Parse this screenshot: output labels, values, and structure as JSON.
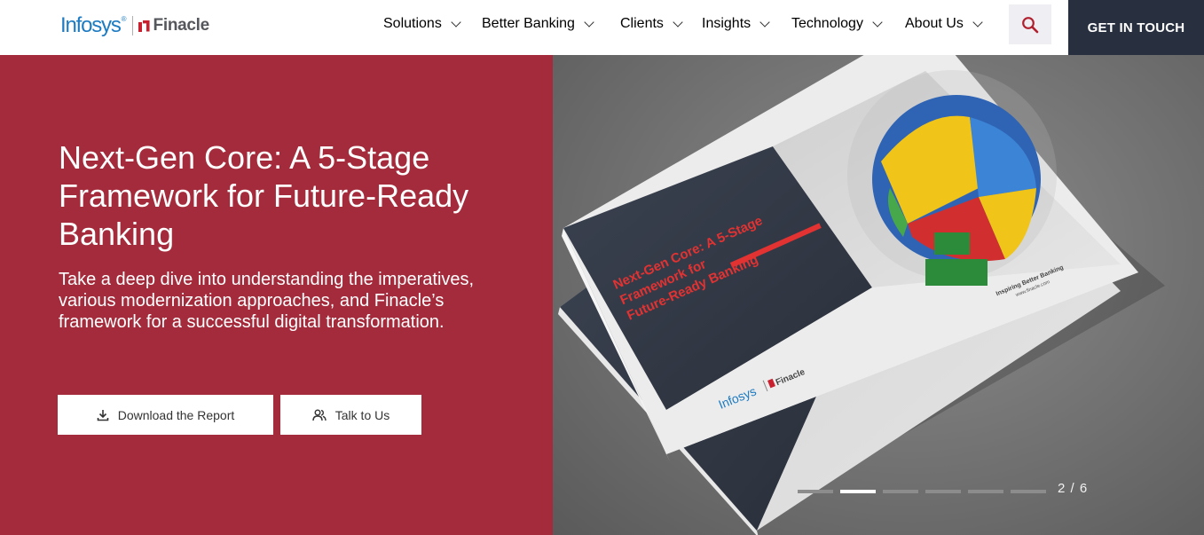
{
  "brand": {
    "infosys": "Infosys",
    "finacle": "Finacle",
    "primary_color": "#1d7bc2",
    "accent_color": "#c8202f"
  },
  "nav": {
    "items": [
      {
        "label": "Solutions",
        "icon": "chevron-down-icon"
      },
      {
        "label": "Better Banking",
        "icon": "chevron-down-icon"
      },
      {
        "label": "Clients",
        "icon": "chevron-down-icon"
      },
      {
        "label": "Insights",
        "icon": "chevron-down-icon"
      },
      {
        "label": "Technology",
        "icon": "chevron-down-icon"
      },
      {
        "label": "About Us",
        "icon": "chevron-down-icon"
      }
    ],
    "search_icon": "search-icon",
    "cta_label": "GET IN TOUCH"
  },
  "hero": {
    "title": "Next-Gen Core: A 5-Stage Framework for Future-Ready Banking",
    "description": "Take a deep dive into understanding the imperatives, various modernization approaches, and Finacle’s framework for a successful digital transformation.",
    "buttons": {
      "download": {
        "label": "Download the Report",
        "icon": "download-icon"
      },
      "talk": {
        "label": "Talk to Us",
        "icon": "users-icon"
      }
    },
    "background_color": "#a42b3b"
  },
  "report_image": {
    "cover_title": "Next-Gen Core: A 5-Stage Framework for Future-Ready Banking",
    "tagline": "Inspiring Better Banking",
    "url": "www.finacle.com",
    "brand_infosys": "Infosys",
    "brand_finacle": "Finacle"
  },
  "carousel": {
    "current": 2,
    "total": 6,
    "counter": "2 / 6"
  }
}
